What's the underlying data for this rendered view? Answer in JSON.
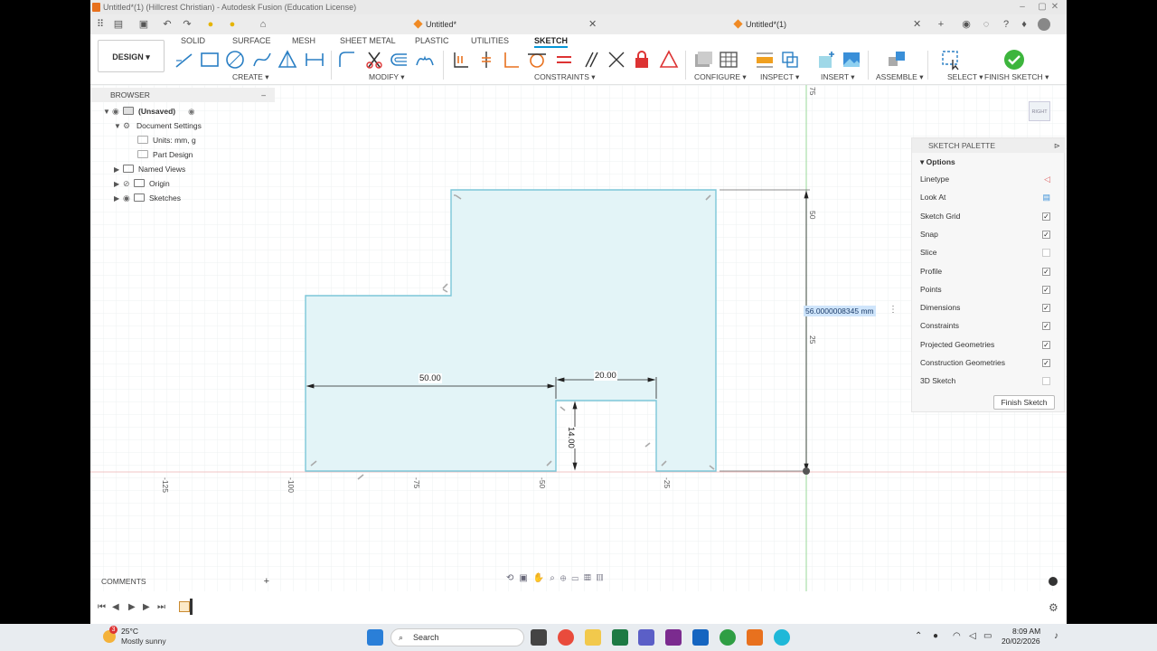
{
  "window": {
    "title": "Untitled*(1) (Hillcrest Christian) - Autodesk Fusion (Education License)"
  },
  "doc_tabs": [
    {
      "label": "Untitled*"
    },
    {
      "label": "Untitled*(1)"
    }
  ],
  "ribbon": {
    "workspace": "DESIGN",
    "tabs": [
      "SOLID",
      "SURFACE",
      "MESH",
      "SHEET METAL",
      "PLASTIC",
      "UTILITIES",
      "SKETCH"
    ],
    "active_tab": "SKETCH",
    "groups": [
      "CREATE",
      "MODIFY",
      "CONSTRAINTS",
      "CONFIGURE",
      "INSPECT",
      "INSERT",
      "ASSEMBLE",
      "SELECT",
      "FINISH SKETCH"
    ]
  },
  "browser": {
    "title": "BROWSER",
    "items": [
      {
        "label": "(Unsaved)"
      },
      {
        "label": "Document Settings"
      },
      {
        "label": "Units: mm, g"
      },
      {
        "label": "Part Design"
      },
      {
        "label": "Named Views"
      },
      {
        "label": "Origin"
      },
      {
        "label": "Sketches"
      }
    ]
  },
  "sketch": {
    "dims": {
      "d1": "50.00",
      "d2": "20.00",
      "d3": "14.00"
    },
    "input_value": "56.0000008345 mm",
    "axis_x": [
      "-125",
      "-100",
      "-75",
      "-50",
      "-25"
    ],
    "axis_y": [
      "75",
      "50",
      "25"
    ],
    "viewcube": "RIGHT"
  },
  "palette": {
    "title": "SKETCH PALETTE",
    "section": "Options",
    "rows": [
      {
        "label": "Linetype",
        "checked": null
      },
      {
        "label": "Look At",
        "checked": null
      },
      {
        "label": "Sketch Grid",
        "checked": true
      },
      {
        "label": "Snap",
        "checked": true
      },
      {
        "label": "Slice",
        "checked": false
      },
      {
        "label": "Profile",
        "checked": true
      },
      {
        "label": "Points",
        "checked": true
      },
      {
        "label": "Dimensions",
        "checked": true
      },
      {
        "label": "Constraints",
        "checked": true
      },
      {
        "label": "Projected Geometries",
        "checked": true
      },
      {
        "label": "Construction Geometries",
        "checked": true
      },
      {
        "label": "3D Sketch",
        "checked": false
      }
    ],
    "finish_label": "Finish Sketch"
  },
  "comments": {
    "label": "COMMENTS"
  },
  "taskbar": {
    "temp": "25°C",
    "weather": "Mostly sunny",
    "search": "Search",
    "time": "8:09 AM",
    "date": "20/02/2026",
    "badge": "3"
  },
  "colors": {
    "accent": "#0696d7",
    "sketch_fill": "#e3f4f7",
    "sketch_line": "#7cc6d8",
    "green_axis": "#7ccf7c",
    "red_axis": "#e8a0a0"
  }
}
